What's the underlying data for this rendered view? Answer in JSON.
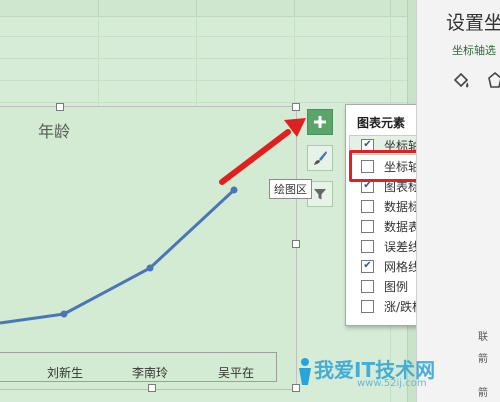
{
  "chart": {
    "title": "年龄",
    "categories": [
      "刘新生",
      "李南玲",
      "吴平在"
    ],
    "tooltip": "绘图区"
  },
  "chart_elements_popup": {
    "title": "图表元素",
    "items": [
      {
        "label": "坐标轴",
        "checked": true
      },
      {
        "label": "坐标轴标题",
        "checked": false
      },
      {
        "label": "图表标题",
        "checked": true
      },
      {
        "label": "数据标签",
        "checked": false
      },
      {
        "label": "数据表",
        "checked": false
      },
      {
        "label": "误差线",
        "checked": false
      },
      {
        "label": "网格线",
        "checked": true
      },
      {
        "label": "图例",
        "checked": false
      },
      {
        "label": "涨/跌柱线",
        "checked": false
      }
    ]
  },
  "format_panel": {
    "title": "设置坐",
    "subtitle": "坐标轴选",
    "side_label_1": "联",
    "side_label_2": "箭",
    "side_label_3": "箭"
  },
  "watermark": {
    "text": "我爱IT技术网",
    "url": "www.52ij.com"
  },
  "colors": {
    "sheet_bg": "#d7ecd6",
    "line": "#4a76b8",
    "highlight_red": "#e21f26",
    "arrow_red": "#e02020",
    "plus_button": "#5aa56a"
  }
}
